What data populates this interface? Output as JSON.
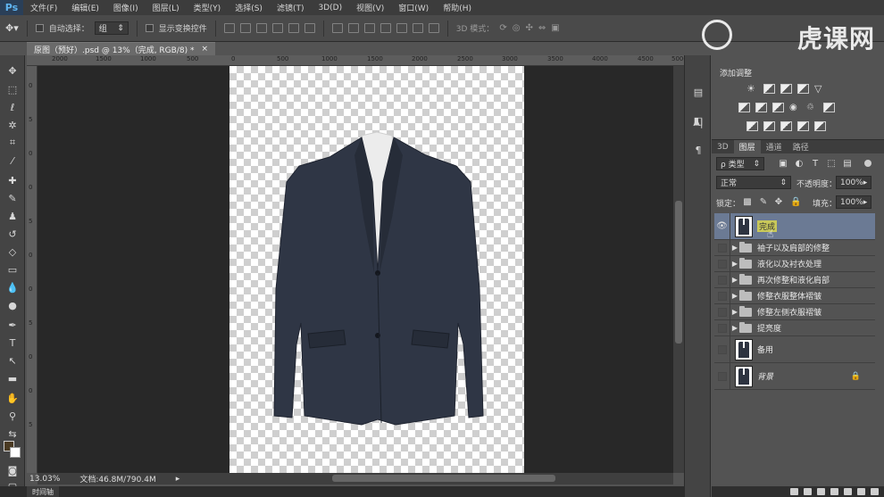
{
  "menubar": {
    "logo": "Ps",
    "items": [
      "文件(F)",
      "编辑(E)",
      "图像(I)",
      "图层(L)",
      "类型(Y)",
      "选择(S)",
      "滤镜(T)",
      "3D(D)",
      "视图(V)",
      "窗口(W)",
      "帮助(H)"
    ]
  },
  "options": {
    "auto_select_label": "自动选择：",
    "auto_select_value": "组",
    "show_transform_label": "显示变换控件",
    "mode_3d_label": "3D 模式："
  },
  "watermark": {
    "text": "虎课网"
  },
  "document": {
    "tab_title": "原图（预好）.psd @ 13%（完成, RGB/8) *",
    "close_glyph": "×",
    "zoom": "13.03%",
    "doc_info": "文档:46.8M/790.4M",
    "timeline_label": "时间轴"
  },
  "ruler_h": [
    "2000",
    "1500",
    "1000",
    "500",
    "0",
    "500",
    "1000",
    "1500",
    "2000",
    "2500",
    "3000",
    "3500",
    "4000",
    "4500",
    "5000"
  ],
  "ruler_v": [
    "0",
    "5",
    "0",
    "0",
    "5",
    "0",
    "0",
    "5",
    "0",
    "0",
    "5"
  ],
  "adjustments": {
    "title": "添加调整"
  },
  "layers_panel": {
    "tabs": [
      "3D",
      "图层",
      "通道",
      "路径"
    ],
    "active_tab": 1,
    "filter_label": "ρ 类型",
    "blend_mode": "正常",
    "opacity_label": "不透明度：",
    "opacity_value": "100%",
    "lock_label": "锁定：",
    "fill_label": "填充：",
    "fill_value": "100%",
    "layers": [
      {
        "name": "完成",
        "type": "layer",
        "visible": true,
        "selected": true
      },
      {
        "name": "袖子以及肩部的修整",
        "type": "group"
      },
      {
        "name": "液化以及衬衣处理",
        "type": "group"
      },
      {
        "name": "再次修整和液化肩部",
        "type": "group"
      },
      {
        "name": "修整衣服整体褶皱",
        "type": "group"
      },
      {
        "name": "修整左侧衣服褶皱",
        "type": "group"
      },
      {
        "name": "提亮度",
        "type": "group"
      },
      {
        "name": "备用",
        "type": "layer"
      },
      {
        "name": "背景",
        "type": "layer",
        "locked": true
      }
    ]
  },
  "colors": {
    "jacket": "#2d3340",
    "shirt": "#e9e9e9",
    "selection": "#6b7a94",
    "panel": "#535353"
  }
}
